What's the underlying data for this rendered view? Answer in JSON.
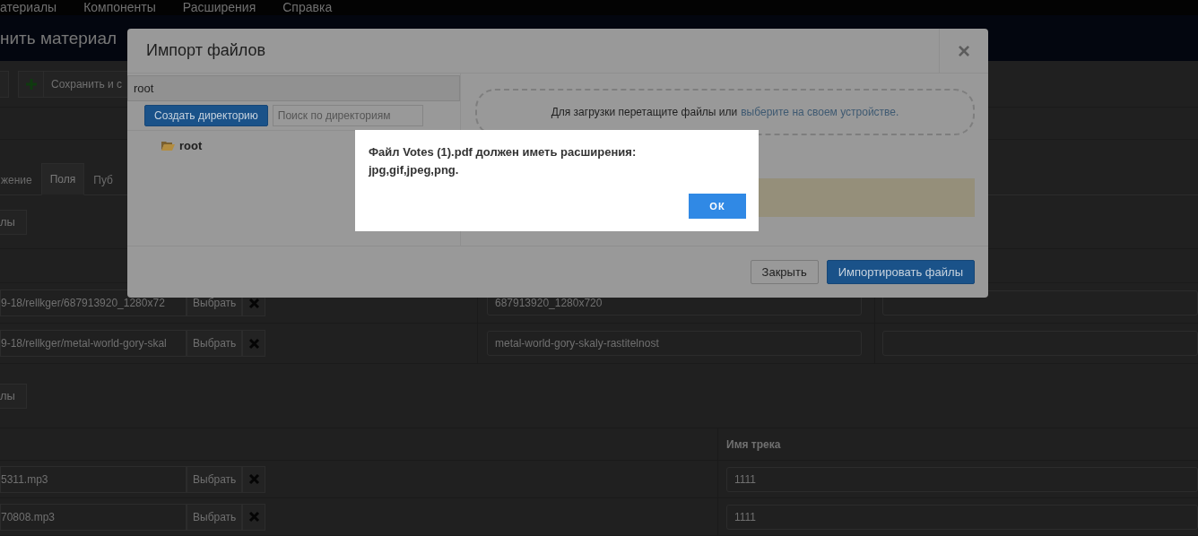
{
  "menu": [
    "атериалы",
    "Компоненты",
    "Расширения",
    "Справка"
  ],
  "page_title": "нить материал",
  "toolbar": {
    "save_button": "Сохранить и с"
  },
  "tabs": [
    {
      "label": "жение",
      "selected": false
    },
    {
      "label": "Поля",
      "selected": true
    },
    {
      "label": "Пуб",
      "selected": false
    }
  ],
  "images_section": {
    "add_button": "лы",
    "rows": [
      {
        "path": "9-18/rellkger/687913920_1280x72",
        "select": "Выбрать",
        "name": "687913920_1280x720"
      },
      {
        "path": "9-18/rellkger/metal-world-gory-skal",
        "select": "Выбрать",
        "name": "metal-world-gory-skaly-rastitelnost"
      }
    ]
  },
  "audio_section": {
    "add_button": "лы",
    "column_header": "Имя трека",
    "rows": [
      {
        "path": "5311.mp3",
        "select": "Выбрать",
        "name": "1111"
      },
      {
        "path": "70808.mp3",
        "select": "Выбрать",
        "name": "1111"
      }
    ]
  },
  "import_dialog": {
    "title": "Импорт файлов",
    "close": "×",
    "path": "root",
    "create_button": "Создать директорию",
    "search": {
      "placeholder": "Поиск по директориям"
    },
    "tree": [
      {
        "label": "root",
        "expanded": true
      }
    ],
    "dropzone": {
      "text": "Для загрузки перетащите файлы или",
      "link": "выберите на своем устройстве."
    },
    "buttons": [
      {
        "label": "Закрыть",
        "kind": "default"
      },
      {
        "label": "Импортировать файлы",
        "kind": "primary"
      }
    ]
  },
  "alert": {
    "message": "Файл Votes (1).pdf должен иметь расширения: jpg,gif,jpeg,png.",
    "button": "ОК"
  }
}
